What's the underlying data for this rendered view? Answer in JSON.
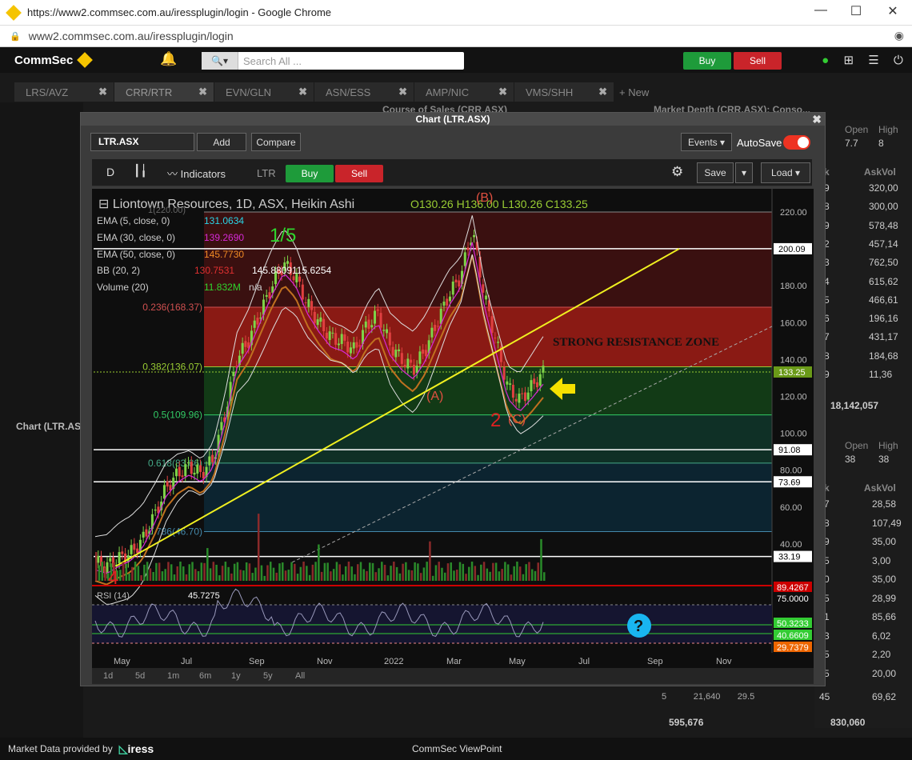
{
  "browser": {
    "title": "https://www2.commsec.com.au/iressplugin/login - Google Chrome",
    "url": "www2.commsec.com.au/iressplugin/login"
  },
  "app": {
    "logo": "CommSec",
    "search_placeholder": "Search All ...",
    "buy": "Buy",
    "sell": "Sell"
  },
  "tabs": [
    {
      "label": "LRS/AVZ"
    },
    {
      "label": "CRR/RTR"
    },
    {
      "label": "EVN/GLN"
    },
    {
      "label": "ASN/ESS"
    },
    {
      "label": "AMP/NIC"
    },
    {
      "label": "VMS/SHH"
    },
    {
      "label": "+ New"
    }
  ],
  "panels": {
    "course_of_sales": "Course of Sales (CRR.ASX)",
    "market_depth": "Market Depth (CRR.ASX): Conso...",
    "chart_label": "Chart (LTR.AS"
  },
  "depth": {
    "open1": "Open",
    "high1": "High",
    "open1_val": "7.7",
    "high1_val": "8",
    "k_header": "k",
    "askvol_header": "AskVol",
    "rows1": [
      {
        "c": "9",
        "v": "320,00"
      },
      {
        "c": "8",
        "v": "300,00"
      },
      {
        "c": "9",
        "v": "578,48"
      },
      {
        "c": "2",
        "v": "457,14"
      },
      {
        "c": "3",
        "v": "762,50"
      },
      {
        "c": "4",
        "v": "615,62"
      },
      {
        "c": "5",
        "v": "466,61"
      },
      {
        "c": "6",
        "v": "196,16"
      },
      {
        "c": "7",
        "v": "431,17"
      },
      {
        "c": "8",
        "v": "184,68"
      },
      {
        "c": "9",
        "v": "11,36"
      }
    ],
    "total1": "18,142,057",
    "open2": "Open",
    "high2": "High",
    "open2_val": "38",
    "high2_val": "38",
    "rows2": [
      {
        "c": "7",
        "v": "28,58"
      },
      {
        "c": "8",
        "v": "107,49"
      },
      {
        "c": "9",
        "v": "35,00"
      },
      {
        "c": "5",
        "v": "3,00"
      },
      {
        "c": "0",
        "v": "35,00"
      },
      {
        "c": "5",
        "v": "28,99"
      },
      {
        "c": "1",
        "v": "85,66"
      },
      {
        "c": "3",
        "v": "6,02"
      },
      {
        "c": "5",
        "v": "2,20"
      },
      {
        "c": "5",
        "v": "20,00"
      }
    ],
    "last_row": [
      "5",
      "21,640",
      "29.5",
      "45",
      "69,62"
    ],
    "total2_left": "595,676",
    "total2_right": "830,060"
  },
  "chart_window": {
    "title": "Chart (LTR.ASX)",
    "symbol": "LTR.ASX",
    "add": "Add",
    "compare": "Compare",
    "events": "Events",
    "autosave": "AutoSave",
    "interval": "D",
    "indicators": "Indicators",
    "ticker": "LTR",
    "buy": "Buy",
    "sell": "Sell",
    "save": "Save",
    "load": "Load",
    "ranges": [
      "1d",
      "5d",
      "1m",
      "6m",
      "1y",
      "5y",
      "All"
    ]
  },
  "chart_data": {
    "type": "candlestick",
    "title": "Liontown Resources, 1D, ASX, Heikin Ashi",
    "ohlc": {
      "O": "130.26",
      "H": "136.00",
      "L": "130.26",
      "C": "133.25"
    },
    "legend": [
      {
        "label": "EMA (5, close, 0)",
        "value": "131.0634",
        "color": "#29d4e6"
      },
      {
        "label": "EMA (30, close, 0)",
        "value": "139.2690",
        "color": "#d62ad6"
      },
      {
        "label": "EMA (50, close, 0)",
        "value": "145.7730",
        "color": "#f08a24"
      },
      {
        "label": "BB (20, 2)",
        "values": [
          "130.7531",
          "145.8809",
          "115.6254"
        ],
        "colors": [
          "#e03030",
          "#ffffff",
          "#ffffff"
        ]
      },
      {
        "label": "Volume (20)",
        "value": "11.832M",
        "extra": "n/a",
        "color": "#2ed52e"
      }
    ],
    "x_ticks": [
      "May",
      "Jul",
      "Sep",
      "Nov",
      "2022",
      "Mar",
      "May",
      "Jul",
      "Sep",
      "Nov"
    ],
    "y_ticks": [
      220,
      180,
      160,
      140,
      120,
      100,
      80,
      60,
      40
    ],
    "ylim": [
      20,
      230
    ],
    "price_labels": [
      {
        "value": 200.09,
        "text": "200.09"
      },
      {
        "value": 133.25,
        "text": "133.25"
      },
      {
        "value": 91.08,
        "text": "91.08"
      },
      {
        "value": 73.69,
        "text": "73.69"
      },
      {
        "value": 33.19,
        "text": "33.19"
      }
    ],
    "fib_levels": [
      {
        "ratio": "0.236",
        "value": 168.37,
        "text": "0.236(168.37)"
      },
      {
        "ratio": "0.382",
        "value": 136.07,
        "text": "0.382(136.07)"
      },
      {
        "ratio": "0.5",
        "value": 109.96,
        "text": "0.5(109.96)"
      },
      {
        "ratio": "0.618",
        "value": 83.86,
        "text": "0.618(83.86)"
      },
      {
        "ratio": "0.786",
        "value": 46.7,
        "text": "0.786(46.70)"
      }
    ],
    "fib_top_text": "1(220.00)",
    "annotations": [
      "STRONG RESISTANCE ZONE",
      "1/5",
      "(B)",
      "(A)",
      "2",
      "(C)",
      "4"
    ],
    "series": [
      {
        "name": "Price",
        "x": [
          0,
          10,
          20,
          30,
          40,
          50,
          60,
          70,
          80,
          90,
          100,
          110,
          120,
          130,
          140,
          150,
          160,
          170,
          180,
          190,
          200,
          210,
          220,
          230,
          240,
          250,
          260,
          270,
          280,
          290,
          300,
          310,
          320,
          330,
          340,
          350,
          360,
          370,
          380
        ],
        "close": [
          30,
          28,
          32,
          35,
          42,
          55,
          70,
          78,
          82,
          78,
          86,
          110,
          140,
          150,
          165,
          180,
          192,
          185,
          170,
          160,
          152,
          150,
          145,
          158,
          165,
          148,
          140,
          135,
          145,
          160,
          175,
          185,
          210,
          175,
          150,
          125,
          118,
          125,
          133
        ]
      }
    ],
    "rsi": {
      "label": "RSI (14)",
      "value": "45.7275",
      "levels": [
        {
          "text": "89.4267"
        },
        {
          "text": "75.0000"
        },
        {
          "text": "50.3233"
        },
        {
          "text": "40.6609"
        },
        {
          "text": "29.7379"
        }
      ]
    }
  },
  "footer": {
    "provider": "Market Data provided by",
    "brand": "iress",
    "center": "CommSec ViewPoint"
  }
}
